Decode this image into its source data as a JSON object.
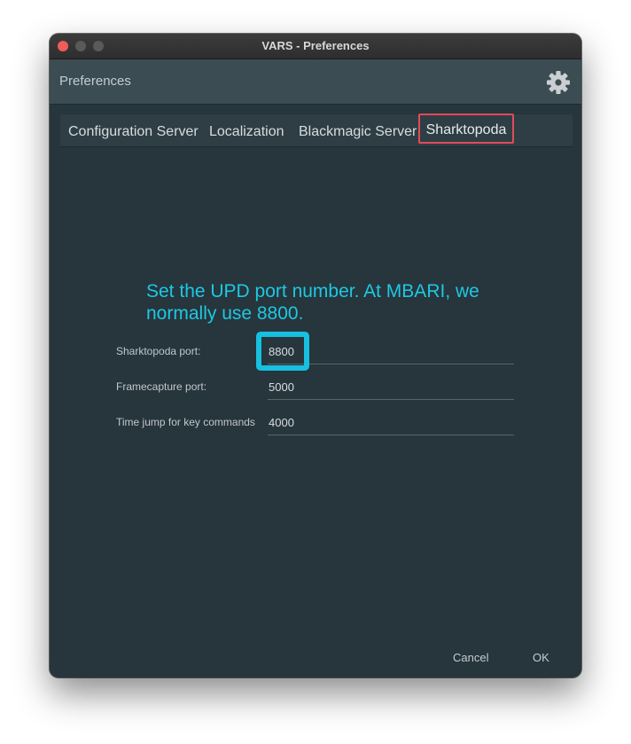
{
  "window": {
    "title": "VARS - Preferences"
  },
  "header": {
    "title": "Preferences",
    "settings_icon": "gear-icon"
  },
  "tabs": [
    {
      "label": "Configuration Server"
    },
    {
      "label": "Localization"
    },
    {
      "label": "Blackmagic Server"
    },
    {
      "label": "Sharktopoda",
      "selected": true
    }
  ],
  "annotation": {
    "text": "Set the UPD port number. At MBARI, we normally use 8800.",
    "color": "#1ec8e2"
  },
  "form": {
    "fields": [
      {
        "label": "Sharktopoda port:",
        "value": "8800"
      },
      {
        "label": "Framecapture port:",
        "value": "5000"
      },
      {
        "label": "Time jump for key commands",
        "value": "4000"
      }
    ]
  },
  "buttons": {
    "cancel": "Cancel",
    "ok": "OK"
  },
  "colors": {
    "background": "#27353c",
    "header": "#3b4c53",
    "selected_tab_outline": "#e04b5a",
    "highlight": "#17bfe0"
  }
}
